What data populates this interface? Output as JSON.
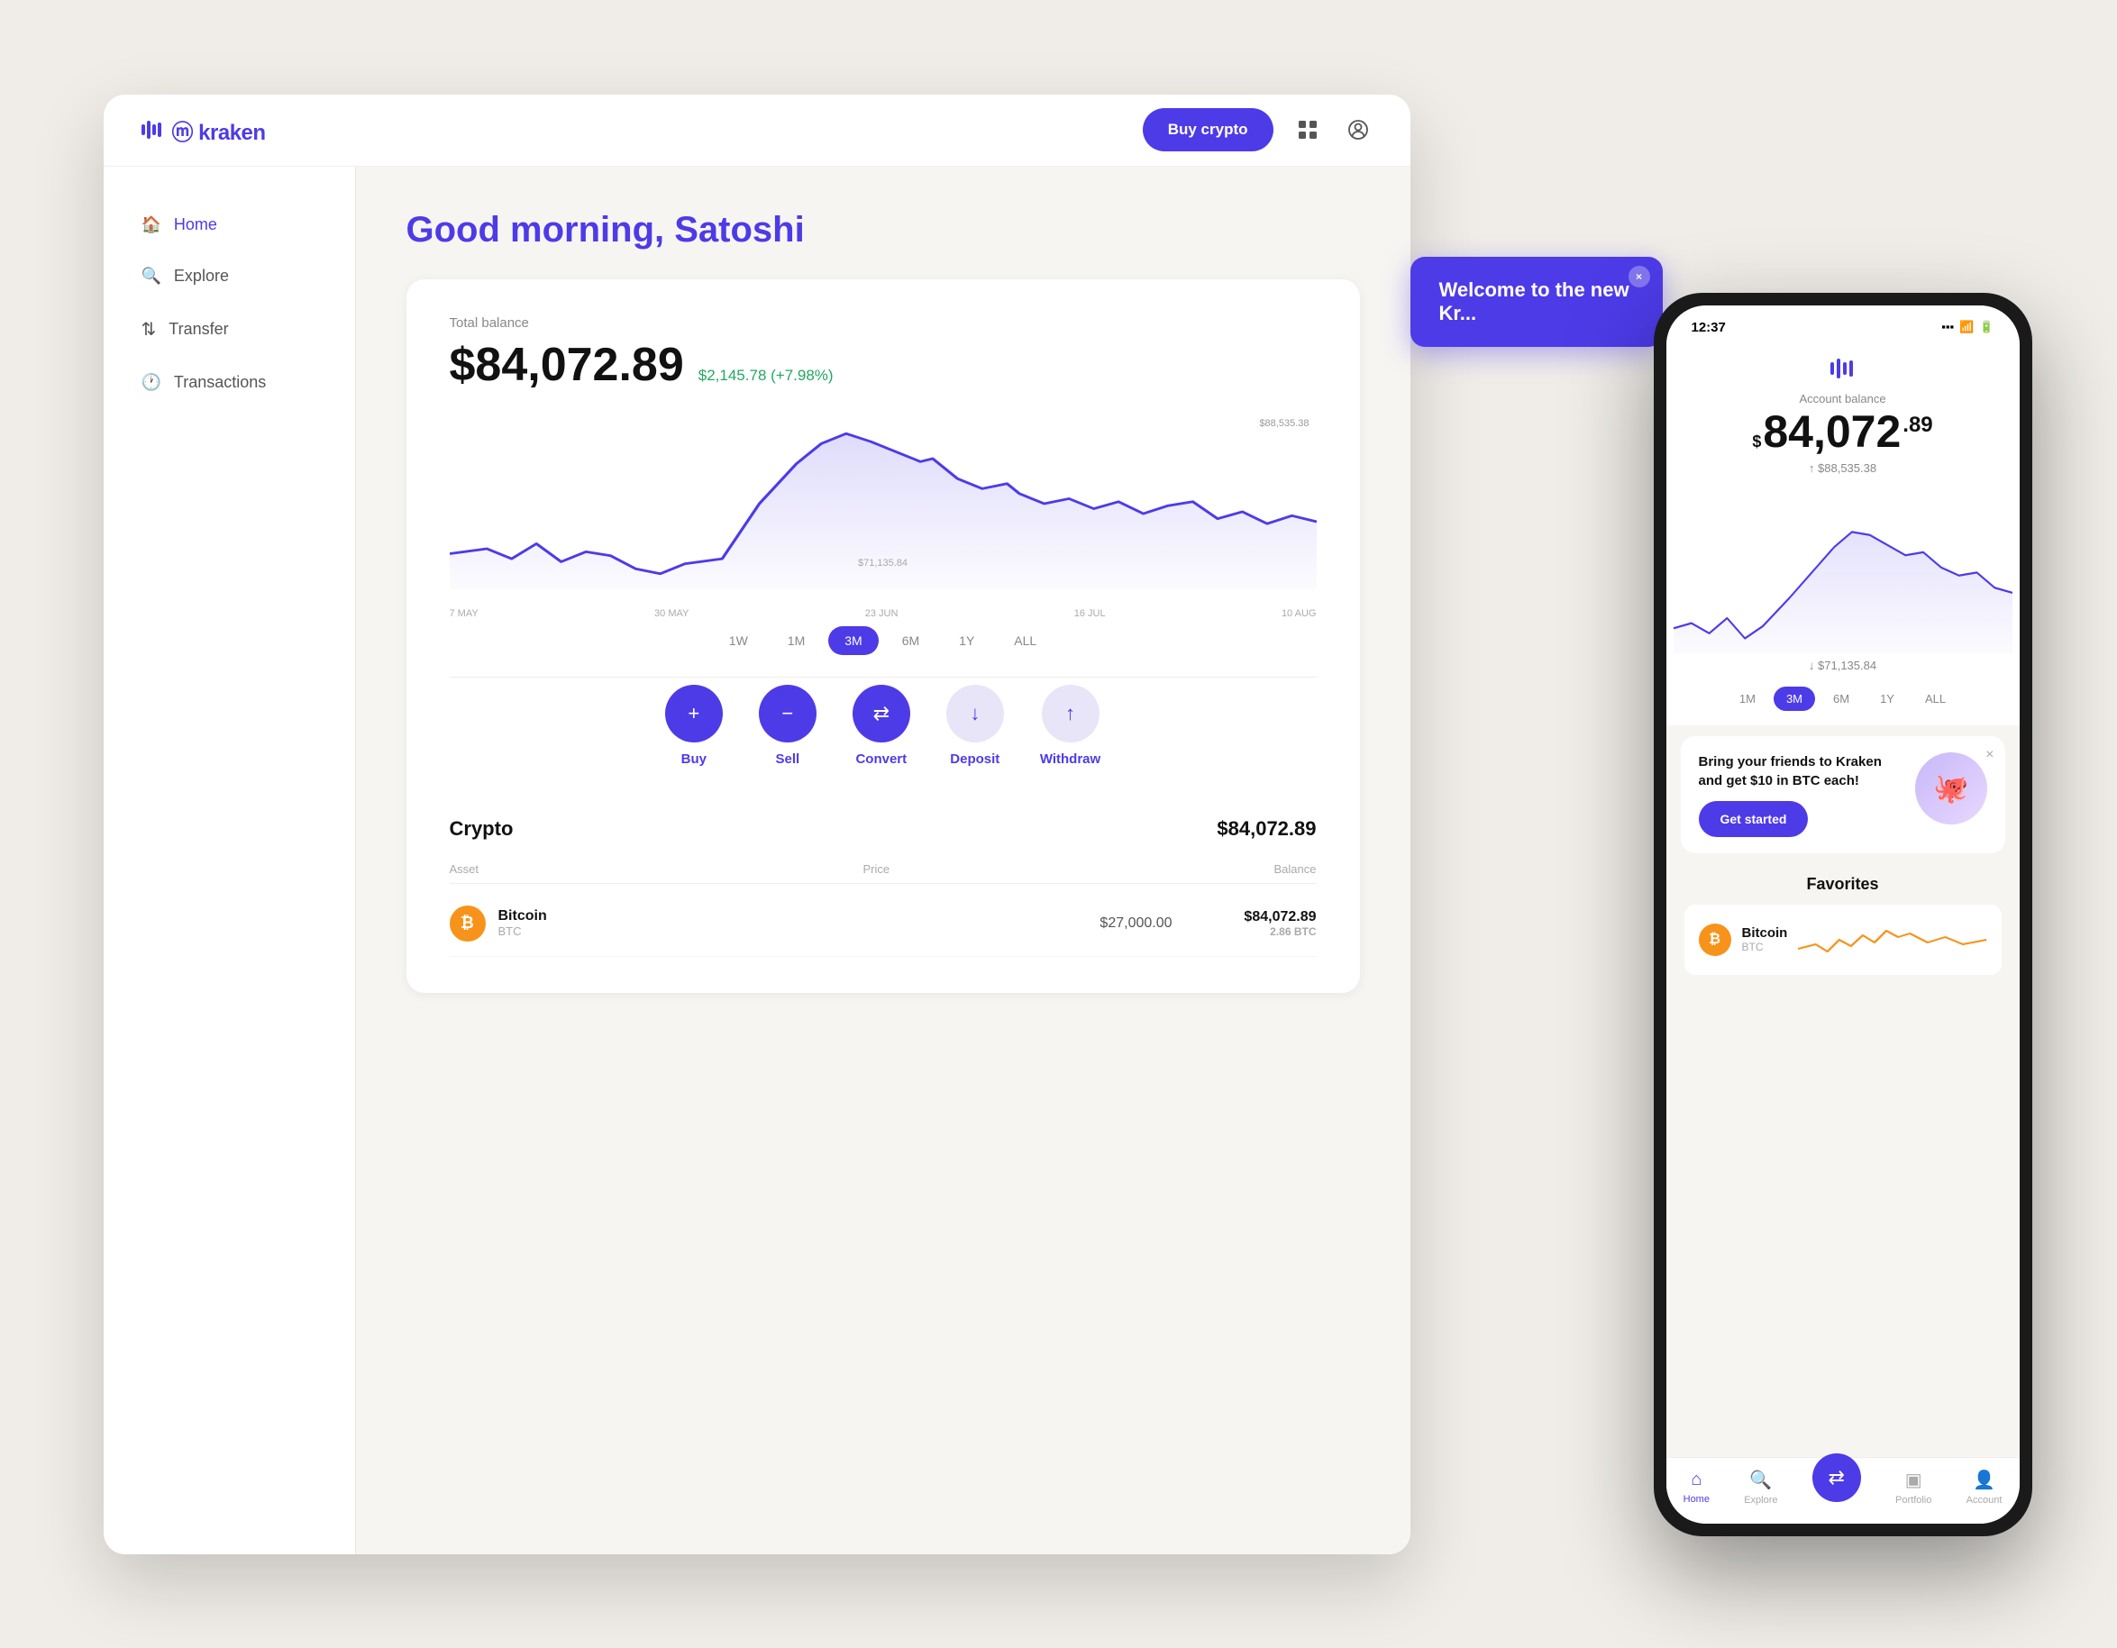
{
  "browser": {
    "logo": "ⓜ kraken",
    "buy_crypto_label": "Buy crypto",
    "grid_icon": "⊞",
    "profile_icon": "⊙"
  },
  "sidebar": {
    "items": [
      {
        "id": "home",
        "label": "Home",
        "icon": "🏠",
        "active": true
      },
      {
        "id": "explore",
        "label": "Explore",
        "icon": "🔍",
        "active": false
      },
      {
        "id": "transfer",
        "label": "Transfer",
        "icon": "↕",
        "active": false
      },
      {
        "id": "transactions",
        "label": "Transactions",
        "icon": "🕐",
        "active": false
      }
    ]
  },
  "main": {
    "greeting": "Good morning, Satoshi",
    "balance": {
      "label": "Total balance",
      "amount": "$84,072.89",
      "change": "$2,145.78 (+7.98%)"
    },
    "chart": {
      "high_label": "$88,535.38",
      "low_label": "$71,135.84",
      "x_labels": [
        "7 MAY",
        "30 MAY",
        "23 JUN",
        "16 JUL",
        "10 AUG"
      ]
    },
    "time_filters": [
      {
        "label": "1W",
        "active": false
      },
      {
        "label": "1M",
        "active": false
      },
      {
        "label": "3M",
        "active": true
      },
      {
        "label": "6M",
        "active": false
      },
      {
        "label": "1Y",
        "active": false
      },
      {
        "label": "ALL",
        "active": false
      }
    ],
    "actions": [
      {
        "id": "buy",
        "label": "Buy",
        "icon": "+",
        "style": "primary"
      },
      {
        "id": "sell",
        "label": "Sell",
        "icon": "−",
        "style": "primary"
      },
      {
        "id": "convert",
        "label": "Convert",
        "icon": "⇄",
        "style": "primary"
      },
      {
        "id": "deposit",
        "label": "Deposit",
        "icon": "↓",
        "style": "light"
      },
      {
        "id": "withdraw",
        "label": "Withdraw",
        "icon": "↑",
        "style": "light"
      }
    ],
    "portfolio": {
      "title": "Crypto",
      "total": "$84,072.89",
      "headers": [
        "Asset",
        "Price",
        "Balance"
      ],
      "assets": [
        {
          "name": "Bitcoin",
          "ticker": "BTC",
          "price": "$27,000.00",
          "balance": "$84,072.89",
          "sub_balance": "2.86 BTC"
        }
      ]
    }
  },
  "welcome_banner": {
    "text": "Welcome to the new Kr...",
    "close_icon": "×"
  },
  "phone": {
    "status_bar": {
      "time": "12:37",
      "signal": "📶",
      "wifi": "WiFi",
      "battery": "🔋"
    },
    "balance_label": "Account balance",
    "balance_main": "$84,072",
    "balance_sup": "$",
    "balance_sub": ".89",
    "high_label": "↑ $88,535.38",
    "low_label": "↓ $71,135.84",
    "time_filters": [
      {
        "label": "1M",
        "active": false
      },
      {
        "label": "3M",
        "active": true
      },
      {
        "label": "6M",
        "active": false
      },
      {
        "label": "1Y",
        "active": false
      },
      {
        "label": "ALL",
        "active": false
      }
    ],
    "referral": {
      "title": "Bring your friends to Kraken and get $10 in BTC each!",
      "button_label": "Get started"
    },
    "favorites_title": "Favorites",
    "favorite_asset": {
      "name": "Bitcoin",
      "ticker": "BTC"
    },
    "nav_items": [
      {
        "id": "home",
        "label": "Home",
        "icon": "⌂",
        "active": true
      },
      {
        "id": "explore",
        "label": "Explore",
        "icon": "🔍",
        "active": false
      },
      {
        "id": "convert",
        "label": "",
        "icon": "⇄",
        "active": false,
        "center": true
      },
      {
        "id": "portfolio",
        "label": "Portfolio",
        "icon": "▣",
        "active": false
      },
      {
        "id": "account",
        "label": "Account",
        "icon": "👤",
        "active": false
      }
    ]
  },
  "colors": {
    "brand": "#4d3be8",
    "brand_light": "#e8e5f8",
    "positive": "#22a861",
    "btc_orange": "#f7931a",
    "text_dark": "#111111",
    "text_mid": "#555555",
    "text_light": "#aaaaaa",
    "bg_main": "#f7f5f2",
    "bg_card": "#ffffff"
  }
}
